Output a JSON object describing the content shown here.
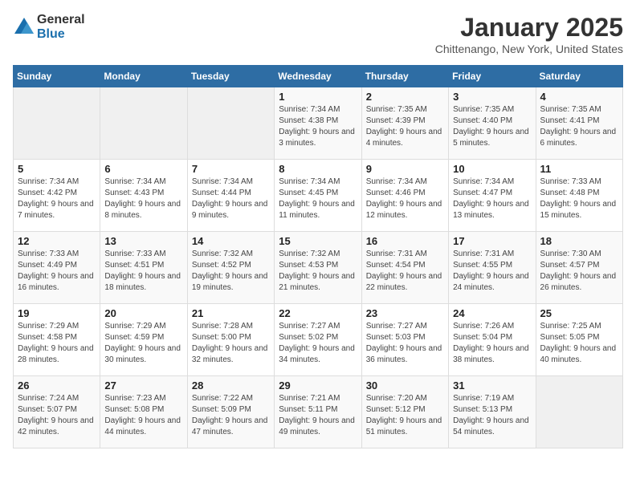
{
  "header": {
    "logo_general": "General",
    "logo_blue": "Blue",
    "month_title": "January 2025",
    "location": "Chittenango, New York, United States"
  },
  "days_of_week": [
    "Sunday",
    "Monday",
    "Tuesday",
    "Wednesday",
    "Thursday",
    "Friday",
    "Saturday"
  ],
  "weeks": [
    [
      {
        "day": "",
        "info": ""
      },
      {
        "day": "",
        "info": ""
      },
      {
        "day": "",
        "info": ""
      },
      {
        "day": "1",
        "info": "Sunrise: 7:34 AM\nSunset: 4:38 PM\nDaylight: 9 hours and 3 minutes."
      },
      {
        "day": "2",
        "info": "Sunrise: 7:35 AM\nSunset: 4:39 PM\nDaylight: 9 hours and 4 minutes."
      },
      {
        "day": "3",
        "info": "Sunrise: 7:35 AM\nSunset: 4:40 PM\nDaylight: 9 hours and 5 minutes."
      },
      {
        "day": "4",
        "info": "Sunrise: 7:35 AM\nSunset: 4:41 PM\nDaylight: 9 hours and 6 minutes."
      }
    ],
    [
      {
        "day": "5",
        "info": "Sunrise: 7:34 AM\nSunset: 4:42 PM\nDaylight: 9 hours and 7 minutes."
      },
      {
        "day": "6",
        "info": "Sunrise: 7:34 AM\nSunset: 4:43 PM\nDaylight: 9 hours and 8 minutes."
      },
      {
        "day": "7",
        "info": "Sunrise: 7:34 AM\nSunset: 4:44 PM\nDaylight: 9 hours and 9 minutes."
      },
      {
        "day": "8",
        "info": "Sunrise: 7:34 AM\nSunset: 4:45 PM\nDaylight: 9 hours and 11 minutes."
      },
      {
        "day": "9",
        "info": "Sunrise: 7:34 AM\nSunset: 4:46 PM\nDaylight: 9 hours and 12 minutes."
      },
      {
        "day": "10",
        "info": "Sunrise: 7:34 AM\nSunset: 4:47 PM\nDaylight: 9 hours and 13 minutes."
      },
      {
        "day": "11",
        "info": "Sunrise: 7:33 AM\nSunset: 4:48 PM\nDaylight: 9 hours and 15 minutes."
      }
    ],
    [
      {
        "day": "12",
        "info": "Sunrise: 7:33 AM\nSunset: 4:49 PM\nDaylight: 9 hours and 16 minutes."
      },
      {
        "day": "13",
        "info": "Sunrise: 7:33 AM\nSunset: 4:51 PM\nDaylight: 9 hours and 18 minutes."
      },
      {
        "day": "14",
        "info": "Sunrise: 7:32 AM\nSunset: 4:52 PM\nDaylight: 9 hours and 19 minutes."
      },
      {
        "day": "15",
        "info": "Sunrise: 7:32 AM\nSunset: 4:53 PM\nDaylight: 9 hours and 21 minutes."
      },
      {
        "day": "16",
        "info": "Sunrise: 7:31 AM\nSunset: 4:54 PM\nDaylight: 9 hours and 22 minutes."
      },
      {
        "day": "17",
        "info": "Sunrise: 7:31 AM\nSunset: 4:55 PM\nDaylight: 9 hours and 24 minutes."
      },
      {
        "day": "18",
        "info": "Sunrise: 7:30 AM\nSunset: 4:57 PM\nDaylight: 9 hours and 26 minutes."
      }
    ],
    [
      {
        "day": "19",
        "info": "Sunrise: 7:29 AM\nSunset: 4:58 PM\nDaylight: 9 hours and 28 minutes."
      },
      {
        "day": "20",
        "info": "Sunrise: 7:29 AM\nSunset: 4:59 PM\nDaylight: 9 hours and 30 minutes."
      },
      {
        "day": "21",
        "info": "Sunrise: 7:28 AM\nSunset: 5:00 PM\nDaylight: 9 hours and 32 minutes."
      },
      {
        "day": "22",
        "info": "Sunrise: 7:27 AM\nSunset: 5:02 PM\nDaylight: 9 hours and 34 minutes."
      },
      {
        "day": "23",
        "info": "Sunrise: 7:27 AM\nSunset: 5:03 PM\nDaylight: 9 hours and 36 minutes."
      },
      {
        "day": "24",
        "info": "Sunrise: 7:26 AM\nSunset: 5:04 PM\nDaylight: 9 hours and 38 minutes."
      },
      {
        "day": "25",
        "info": "Sunrise: 7:25 AM\nSunset: 5:05 PM\nDaylight: 9 hours and 40 minutes."
      }
    ],
    [
      {
        "day": "26",
        "info": "Sunrise: 7:24 AM\nSunset: 5:07 PM\nDaylight: 9 hours and 42 minutes."
      },
      {
        "day": "27",
        "info": "Sunrise: 7:23 AM\nSunset: 5:08 PM\nDaylight: 9 hours and 44 minutes."
      },
      {
        "day": "28",
        "info": "Sunrise: 7:22 AM\nSunset: 5:09 PM\nDaylight: 9 hours and 47 minutes."
      },
      {
        "day": "29",
        "info": "Sunrise: 7:21 AM\nSunset: 5:11 PM\nDaylight: 9 hours and 49 minutes."
      },
      {
        "day": "30",
        "info": "Sunrise: 7:20 AM\nSunset: 5:12 PM\nDaylight: 9 hours and 51 minutes."
      },
      {
        "day": "31",
        "info": "Sunrise: 7:19 AM\nSunset: 5:13 PM\nDaylight: 9 hours and 54 minutes."
      },
      {
        "day": "",
        "info": ""
      }
    ]
  ]
}
